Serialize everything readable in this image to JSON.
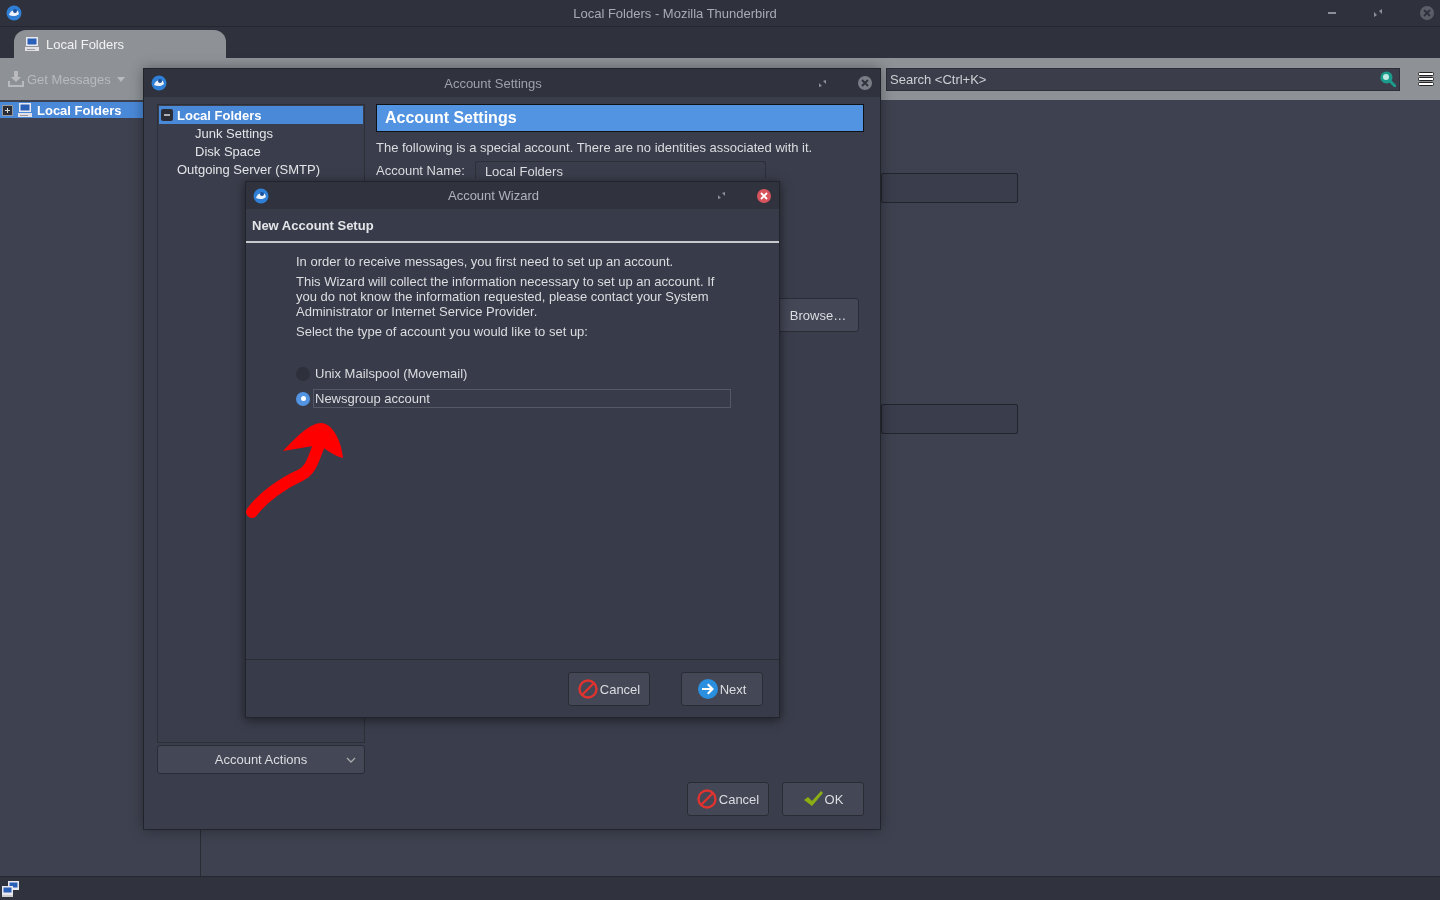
{
  "main_window": {
    "title": "Local Folders - Mozilla Thunderbird",
    "tabs": [
      {
        "label": "Local Folders",
        "selected": true
      }
    ],
    "toolbar": {
      "get_messages": "Get Messages",
      "search": {
        "placeholder": "Search <Ctrl+K>"
      }
    },
    "folder_tree": [
      {
        "label": "Local Folders",
        "selected": true,
        "expanded": false
      }
    ]
  },
  "account_settings": {
    "title": "Account Settings",
    "tree": [
      {
        "label": "Local Folders",
        "selected": true,
        "expanded": true,
        "children": [
          {
            "label": "Junk Settings",
            "selected": false
          },
          {
            "label": "Disk Space",
            "selected": false
          }
        ]
      },
      {
        "label": "Outgoing Server (SMTP)",
        "selected": false
      }
    ],
    "account_actions": "Account Actions",
    "heading": "Account Settings",
    "description": "The following is a special account. There are no identities associated with it.",
    "account_name": {
      "label": "Account Name:",
      "value": "Local Folders"
    },
    "browse_button": "Browse…",
    "buttons": [
      {
        "kind": "cancel",
        "label": "Cancel"
      },
      {
        "kind": "ok",
        "label": "OK"
      }
    ]
  },
  "wizard": {
    "title": "Account Wizard",
    "heading": "New Account Setup",
    "paragraphs": [
      "In order to receive messages, you first need to set up an account.",
      "This Wizard will collect the information necessary to set up an account. If you do not know the information requested, please contact your System Administrator or Internet Service Provider.",
      "Select the type of account you would like to set up:"
    ],
    "options": [
      {
        "label": "Unix Mailspool (Movemail)",
        "selected": false
      },
      {
        "label": "Newsgroup account",
        "selected": true
      }
    ],
    "buttons": [
      {
        "kind": "cancel",
        "label": "Cancel"
      },
      {
        "kind": "next",
        "label": "Next"
      }
    ]
  }
}
